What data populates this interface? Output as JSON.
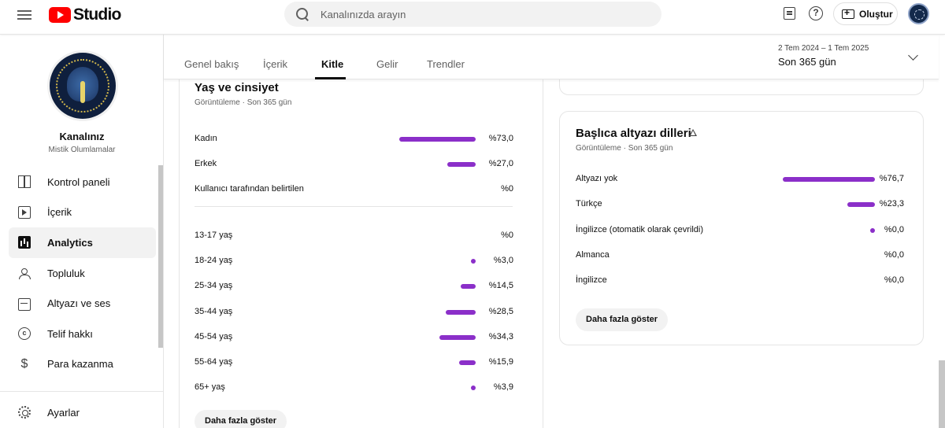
{
  "header": {
    "logo_text": "Studio",
    "search_placeholder": "Kanalınızda arayın",
    "create_label": "Oluştur"
  },
  "sidebar": {
    "channel_name": "Kanalınız",
    "channel_handle": "Mistik Olumlamalar",
    "items": [
      {
        "label": "Kontrol paneli",
        "icon": "dashboard-icon"
      },
      {
        "label": "İçerik",
        "icon": "content-icon"
      },
      {
        "label": "Analytics",
        "icon": "analytics-icon",
        "active": true
      },
      {
        "label": "Topluluk",
        "icon": "community-icon"
      },
      {
        "label": "Altyazı ve ses",
        "icon": "subtitles-icon"
      },
      {
        "label": "Telif hakkı",
        "icon": "copyright-icon"
      },
      {
        "label": "Para kazanma",
        "icon": "monetization-icon"
      }
    ],
    "settings_label": "Ayarlar"
  },
  "tabs": {
    "items": [
      "Genel bakış",
      "İçerik",
      "Kitle",
      "Gelir",
      "Trendler"
    ],
    "active": "Kitle"
  },
  "date": {
    "range": "2 Tem 2024 – 1 Tem 2025",
    "label": "Son 365 gün"
  },
  "age_gender": {
    "title": "Yaş ve cinsiyet",
    "subtitle": "Görüntüleme · Son 365 gün",
    "gender": [
      {
        "label": "Kadın",
        "value": "%73,0",
        "pct": 73.0
      },
      {
        "label": "Erkek",
        "value": "%27,0",
        "pct": 27.0
      },
      {
        "label": "Kullanıcı tarafından belirtilen",
        "value": "%0",
        "pct": 0
      }
    ],
    "age": [
      {
        "label": "13-17 yaş",
        "value": "%0",
        "pct": 0
      },
      {
        "label": "18-24 yaş",
        "value": "%3,0",
        "pct": 3.0
      },
      {
        "label": "25-34 yaş",
        "value": "%14,5",
        "pct": 14.5
      },
      {
        "label": "35-44 yaş",
        "value": "%28,5",
        "pct": 28.5
      },
      {
        "label": "45-54 yaş",
        "value": "%34,3",
        "pct": 34.3
      },
      {
        "label": "55-64 yaş",
        "value": "%15,9",
        "pct": 15.9
      },
      {
        "label": "65+ yaş",
        "value": "%3,9",
        "pct": 3.9
      }
    ],
    "more_label": "Daha fazla göster"
  },
  "subtitles": {
    "title": "Başlıca altyazı dilleri",
    "subtitle": "Görüntüleme · Son 365 gün",
    "rows": [
      {
        "label": "Altyazı yok",
        "value": "%76,7",
        "pct": 76.7
      },
      {
        "label": "Türkçe",
        "value": "%23,3",
        "pct": 23.3
      },
      {
        "label": "İngilizce (otomatik olarak çevrildi)",
        "value": "%0,0",
        "pct": 0.02
      },
      {
        "label": "Almanca",
        "value": "%0,0",
        "pct": 0
      },
      {
        "label": "İngilizce",
        "value": "%0,0",
        "pct": 0
      }
    ],
    "more_label": "Daha fazla göster"
  },
  "colors": {
    "bar": "#8b2fc9",
    "brand": "#ff0000"
  }
}
